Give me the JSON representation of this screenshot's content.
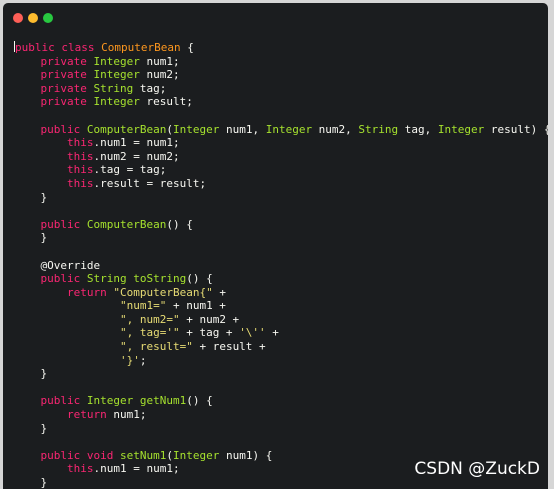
{
  "window": {
    "controls": {
      "close": "close",
      "minimize": "minimize",
      "zoom": "zoom"
    }
  },
  "code_lines": [
    "public class ComputerBean {",
    "    private Integer num1;",
    "    private Integer num2;",
    "    private String tag;",
    "    private Integer result;",
    "",
    "    public ComputerBean(Integer num1, Integer num2, String tag, Integer result) {",
    "        this.num1 = num1;",
    "        this.num2 = num2;",
    "        this.tag = tag;",
    "        this.result = result;",
    "    }",
    "",
    "    public ComputerBean() {",
    "    }",
    "",
    "    @Override",
    "    public String toString() {",
    "        return \"ComputerBean{\" +",
    "                \"num1=\" + num1 +",
    "                \", num2=\" + num2 +",
    "                \", tag='\" + tag + '\\'' +",
    "                \", result=\" + result +",
    "                '}';",
    "    }",
    "",
    "    public Integer getNum1() {",
    "        return num1;",
    "    }",
    "",
    "    public void setNum1(Integer num1) {",
    "        this.num1 = num1;",
    "    }"
  ],
  "watermark": "CSDN @ZuckD",
  "colors": {
    "background": "#1b1d1f",
    "keyword": "#f92672",
    "type": "#a6e22e",
    "string": "#e6db74",
    "class_name": "#fd971f",
    "text": "#f8f8f2"
  }
}
